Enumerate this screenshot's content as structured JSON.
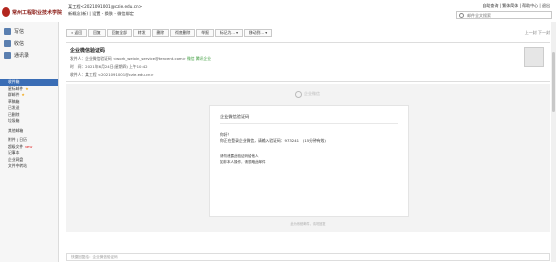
{
  "header": {
    "logo_text": "常州工程职业技术学院",
    "user_line": "某工程<2021091001@czie.edu.cn>",
    "user_links": "新概念(新) | 设置 - 换肤 - 微信绑定",
    "top_links": "自助查询 | 繁体简体 | 帮助中心 | 退出",
    "search_placeholder": "邮件全文搜索"
  },
  "sidebar": {
    "buttons": [
      {
        "label": "写信",
        "icon": "pen-icon"
      },
      {
        "label": "收信",
        "icon": "inbox-icon"
      },
      {
        "label": "通讯录",
        "icon": "contacts-icon"
      }
    ],
    "folders": [
      {
        "label": "收件箱",
        "active": true,
        "star": false,
        "newtag": ""
      },
      {
        "label": "星标邮件",
        "active": false,
        "star": true,
        "newtag": ""
      },
      {
        "label": "群邮件",
        "active": false,
        "star": true,
        "newtag": ""
      },
      {
        "label": "草稿箱",
        "active": false,
        "star": false,
        "newtag": ""
      },
      {
        "label": "已发送",
        "active": false,
        "star": false,
        "newtag": ""
      },
      {
        "label": "已删除",
        "active": false,
        "star": false,
        "newtag": ""
      },
      {
        "label": "垃圾箱",
        "active": false,
        "star": false,
        "newtag": ""
      },
      {
        "label": "",
        "gap": true
      },
      {
        "label": "其他邮箱",
        "active": false,
        "star": false,
        "newtag": ""
      },
      {
        "label": "",
        "gap": true
      },
      {
        "label": "附件 | 日历",
        "active": false,
        "star": false,
        "newtag": ""
      },
      {
        "label": "超级文件",
        "active": false,
        "star": false,
        "newtag": "NEW"
      },
      {
        "label": "记事本",
        "active": false,
        "star": false,
        "newtag": ""
      },
      {
        "label": "企业网盘",
        "active": false,
        "star": false,
        "newtag": ""
      },
      {
        "label": "文件中转站",
        "active": false,
        "star": false,
        "newtag": ""
      }
    ]
  },
  "toolbar": {
    "buttons": [
      "« 返回",
      "回复",
      "回复全部",
      "转发",
      "删除",
      "彻底删除",
      "举报",
      "标记为... ▾",
      "移动到... ▾"
    ],
    "pager": "上一封  下一封"
  },
  "mail": {
    "subject": "企业微信验证码",
    "from_line": "发件人：企业微信验证码 <work_weixin_service@tencent.com>",
    "from_badge": "微信 腾讯企业",
    "time_line": "时　间：2021年6月24日(星期四) 上午10:42",
    "to_line": "收件人：某工程 <2021091001@czie.edu.cn>"
  },
  "body": {
    "brand": "企业微信",
    "card_title": "企业微信验证码",
    "greeting": "你好！",
    "code_line": "你正在登录企业微信，请输入验证码：973241　(15分钟有效)",
    "note1": "请勿泄露此验证码给他人",
    "note2": "如非本人操作，请忽略此邮件",
    "footer": "此为系统邮件，请勿回复"
  },
  "reply": {
    "placeholder": "快捷回复给：企业微信验证码"
  }
}
